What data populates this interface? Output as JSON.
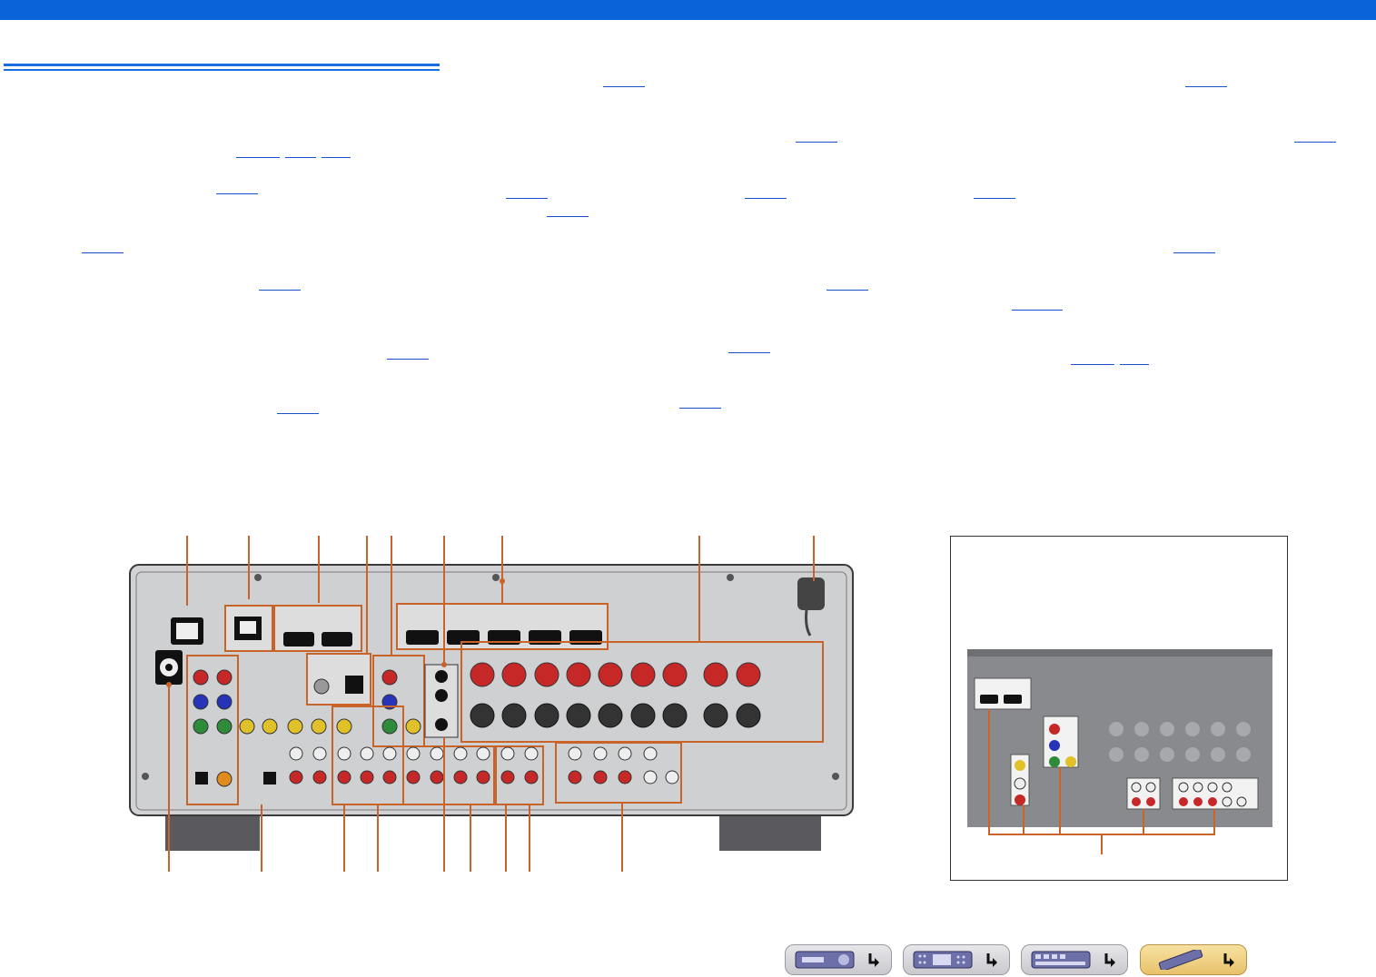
{
  "page": {
    "header_color": "#0a63d9",
    "accent_color": "#1a4fd0",
    "callout_color": "#c8642a",
    "panel_color": "#d4d4d6"
  },
  "reference_links": [
    {
      "id": "ref-1"
    },
    {
      "id": "ref-2"
    },
    {
      "id": "ref-3"
    },
    {
      "id": "ref-4"
    },
    {
      "id": "ref-5"
    },
    {
      "id": "ref-6"
    },
    {
      "id": "ref-7"
    },
    {
      "id": "ref-8"
    },
    {
      "id": "ref-9"
    },
    {
      "id": "ref-10"
    },
    {
      "id": "ref-11"
    },
    {
      "id": "ref-12"
    },
    {
      "id": "ref-13"
    },
    {
      "id": "ref-14"
    },
    {
      "id": "ref-15"
    },
    {
      "id": "ref-16"
    },
    {
      "id": "ref-17"
    },
    {
      "id": "ref-18"
    },
    {
      "id": "ref-19"
    },
    {
      "id": "ref-20"
    },
    {
      "id": "ref-21"
    },
    {
      "id": "ref-22"
    },
    {
      "id": "ref-23"
    },
    {
      "id": "ref-24"
    }
  ],
  "diagram": {
    "subject": "receiver-rear-panel",
    "inset_subject": "zone-output-jacks-detail"
  },
  "nav_buttons": [
    {
      "icon": "front-panel-icon"
    },
    {
      "icon": "front-display-icon"
    },
    {
      "icon": "rear-panel-icon"
    },
    {
      "icon": "remote-control-icon"
    }
  ]
}
